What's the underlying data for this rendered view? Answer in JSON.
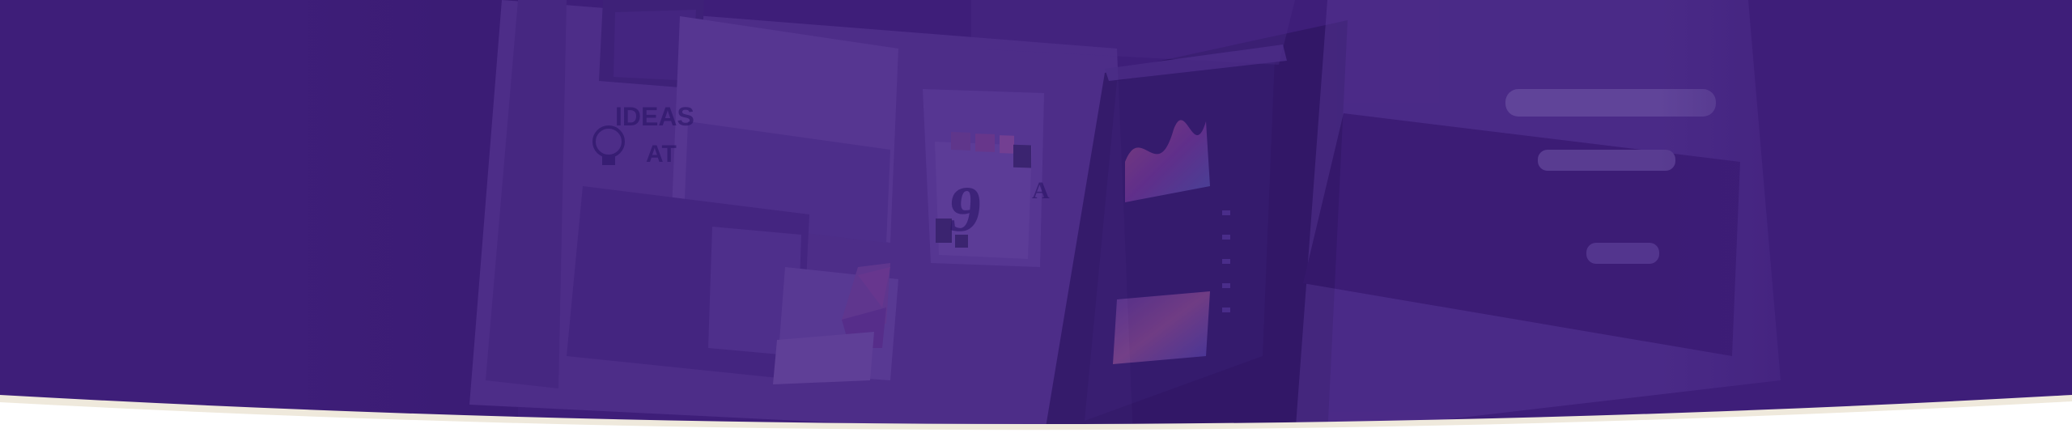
{
  "banner": {
    "background_color": "#3e1e79",
    "curve_accent_color": "#efe9dc",
    "bottom_color": "#ffffff",
    "photo_text": {
      "ideas": "IDEAS",
      "at": "AT",
      "number": "9",
      "superscript": "A"
    },
    "swatches": [
      "#6b3a9a",
      "#8a4a9a",
      "#a05aa8",
      "#3a2a6a"
    ]
  }
}
